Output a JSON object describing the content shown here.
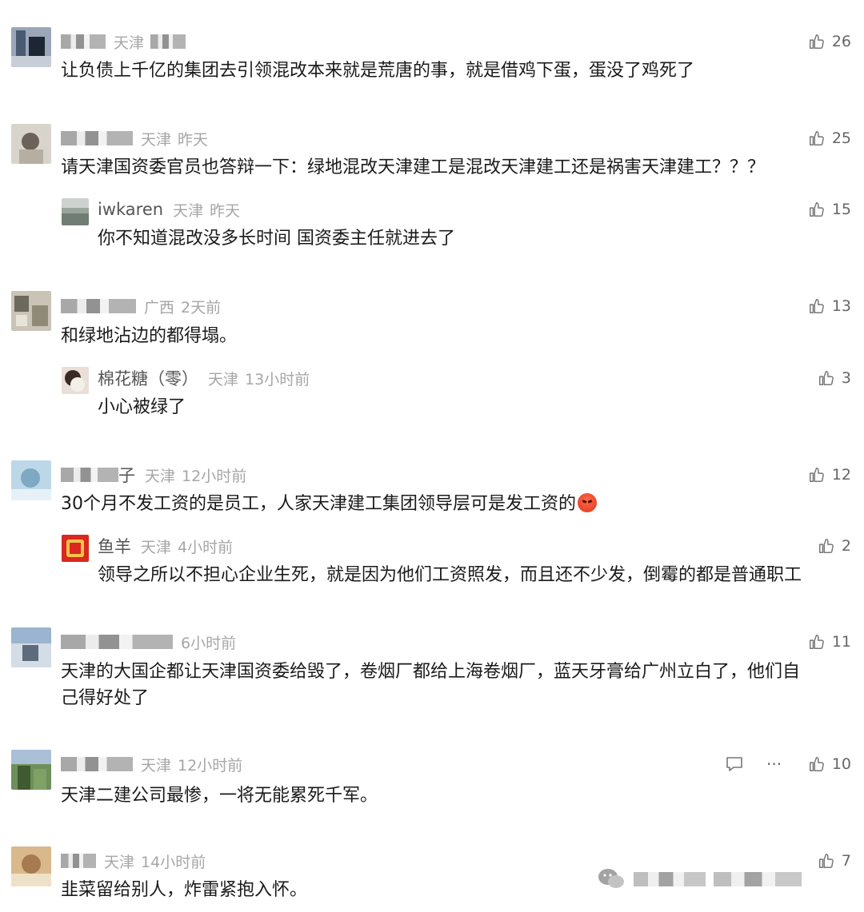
{
  "comments": [
    {
      "name": "",
      "location": "天津",
      "time": "",
      "text": "让负债上千亿的集团去引领混改本来就是荒唐的事，就是借鸡下蛋，蛋没了鸡死了",
      "likes": "26",
      "replies": []
    },
    {
      "name": "",
      "location": "天津",
      "time": "昨天",
      "text": "请天津国资委官员也答辩一下：绿地混改天津建工是混改天津建工还是祸害天津建工？？？",
      "likes": "25",
      "replies": [
        {
          "name": "iwkaren",
          "location": "天津",
          "time": "昨天",
          "text": "你不知道混改没多长时间 国资委主任就进去了",
          "likes": "15"
        }
      ]
    },
    {
      "name": "",
      "location": "广西",
      "time": "2天前",
      "text": "和绿地沾边的都得塌。",
      "likes": "13",
      "replies": [
        {
          "name": "棉花糖（零）",
          "location": "天津",
          "time": "13小时前",
          "text": "小心被绿了",
          "likes": "3"
        }
      ]
    },
    {
      "name": "子",
      "location": "天津",
      "time": "12小时前",
      "text": "30个月不发工资的是员工，人家天津建工集团领导层可是发工资的",
      "emoji": "angry-face",
      "likes": "12",
      "replies": [
        {
          "name": "鱼羊",
          "location": "天津",
          "time": "4小时前",
          "text": "领导之所以不担心企业生死，就是因为他们工资照发，而且还不少发，倒霉的都是普通职工",
          "likes": "2"
        }
      ]
    },
    {
      "name": "",
      "location": "",
      "time": "6小时前",
      "text_line1": "天津的大国企都让天津国资委给毁了，卷烟厂都给上海卷烟厂，蓝天牙膏给广州立白了，他们自",
      "text_line2": "己得好处了",
      "likes": "11",
      "replies": []
    },
    {
      "name": "",
      "location": "天津",
      "time": "12小时前",
      "text": "天津二建公司最惨，一将无能累死千军。",
      "likes": "10",
      "replies": []
    },
    {
      "name": "",
      "location": "天津",
      "time": "14小时前",
      "text": "韭菜留给别人，炸雷紧抱入怀。",
      "likes": "7",
      "replies": []
    }
  ],
  "icons": {
    "like": "thumbs-up-icon",
    "reply": "comment-icon",
    "more": "more-icon",
    "watermark": "wechat-icon"
  },
  "more_label": "···"
}
